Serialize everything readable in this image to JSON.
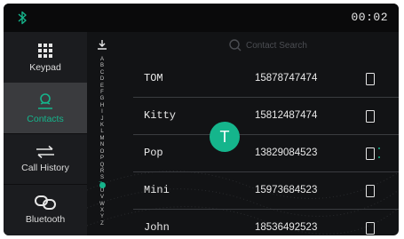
{
  "status": {
    "time": "00:02",
    "bluetooth_icon": "bluetooth-icon"
  },
  "nav": [
    {
      "label": "Keypad",
      "icon": "keypad-icon",
      "active": false
    },
    {
      "label": "Contacts",
      "icon": "contacts-icon",
      "active": true
    },
    {
      "label": "Call History",
      "icon": "call-history-icon",
      "active": false
    },
    {
      "label": "Bluetooth",
      "icon": "bluetooth-link-icon",
      "active": false
    }
  ],
  "search": {
    "placeholder": "Contact Search"
  },
  "alphabet": [
    "A",
    "B",
    "C",
    "D",
    "E",
    "F",
    "G",
    "H",
    "I",
    "J",
    "K",
    "L",
    "M",
    "N",
    "O",
    "P",
    "Q",
    "R",
    "S",
    "T",
    "U",
    "V",
    "W",
    "X",
    "Y",
    "Z"
  ],
  "alphabet_selected": "T",
  "index_bubble": "T",
  "contacts": [
    {
      "name": "TOM",
      "phone": "15878747474"
    },
    {
      "name": "Kitty",
      "phone": "15812487474"
    },
    {
      "name": "Pop",
      "phone": "13829084523"
    },
    {
      "name": "Mini",
      "phone": "15973684523"
    },
    {
      "name": "John",
      "phone": "18536492523"
    }
  ],
  "colors": {
    "accent": "#15b58c",
    "background": "#121315",
    "sidebar": "#1b1c1f",
    "active_nav": "#3a3b3e"
  }
}
